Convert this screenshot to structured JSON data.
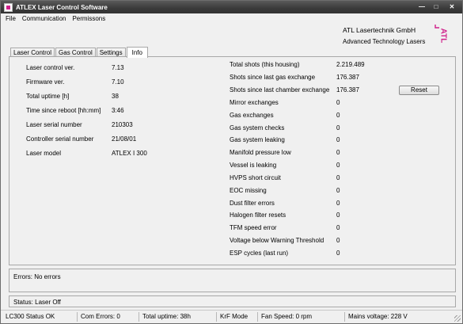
{
  "window": {
    "title": "ATLEX Laser Control Software",
    "minimize_glyph": "—",
    "maximize_glyph": "□",
    "close_glyph": "✕"
  },
  "menu": [
    "File",
    "Communication",
    "Permissons"
  ],
  "header": {
    "company": "ATL Lasertechnik GmbH",
    "tagline": "Advanced Technology Lasers",
    "logo_text": "ATL",
    "logo_color": "#d0208a"
  },
  "tabs": [
    {
      "label": "Laser Control",
      "active": false
    },
    {
      "label": "Gas Control",
      "active": false
    },
    {
      "label": "Settings",
      "active": false
    },
    {
      "label": "Info",
      "active": true
    }
  ],
  "left_info": [
    {
      "label": "Laser control ver.",
      "value": "7.13"
    },
    {
      "label": "Firmware ver.",
      "value": "7.10"
    },
    {
      "label": "Total uptime [h]",
      "value": "38"
    },
    {
      "label": "Time since reboot [hh:mm]",
      "value": "3:46"
    },
    {
      "label": "Laser serial number",
      "value": "210303"
    },
    {
      "label": "Controller serial number",
      "value": "21/08/01"
    },
    {
      "label": "Laser model",
      "value": "ATLEX I 300"
    }
  ],
  "right_info": [
    {
      "label": "Total shots (this housing)",
      "value": "2.219.489"
    },
    {
      "label": "Shots since last gas exchange",
      "value": "176.387"
    },
    {
      "label": "Shots since last chamber exchange",
      "value": "176.387"
    },
    {
      "label": "Mirror exchanges",
      "value": "0"
    },
    {
      "label": "Gas exchanges",
      "value": "0"
    },
    {
      "label": "Gas system checks",
      "value": "0"
    },
    {
      "label": "Gas system leaking",
      "value": "0"
    },
    {
      "label": "Manifold pressure low",
      "value": "0"
    },
    {
      "label": "Vessel is leaking",
      "value": "0"
    },
    {
      "label": "HVPS short circuit",
      "value": "0"
    },
    {
      "label": "EOC missing",
      "value": "0"
    },
    {
      "label": "Dust filter errors",
      "value": "0"
    },
    {
      "label": "Halogen filter resets",
      "value": "0"
    },
    {
      "label": "TFM speed error",
      "value": "0"
    },
    {
      "label": "Voltage below Warning Threshold",
      "value": "0"
    },
    {
      "label": "ESP cycles (last run)",
      "value": "0"
    }
  ],
  "reset_label": "Reset",
  "errors_text": "Errors: No errors",
  "status_text": "Status: Laser Off",
  "statusbar": {
    "lc_status": "LC300 Status OK",
    "com_errors": "Com Errors: 0",
    "uptime": "Total uptime: 38h",
    "mode": "KrF Mode",
    "fan": "Fan Speed: 0 rpm",
    "mains": "Mains voltage: 228 V"
  }
}
